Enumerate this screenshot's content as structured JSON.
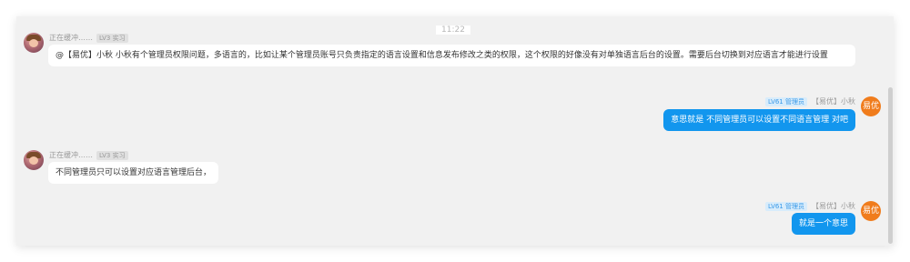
{
  "chat": {
    "timestamp": "11:22",
    "messages": [
      {
        "sender": "正在缓冲……",
        "badge": "LV3 实习",
        "text": "@【易优】小秋 小秋有个管理员权限问题，多语言的，比如让某个管理员账号只负责指定的语言设置和信息发布修改之类的权限，这个权限的好像没有对单独语言后台的设置。需要后台切换到对应语言才能进行设置"
      },
      {
        "sender": "【易优】小秋",
        "badge": "LV61 管理员",
        "avatar_text": "易优",
        "text": "意思就是  不同管理员可以设置不同语言管理 对吧"
      },
      {
        "sender": "正在缓冲……",
        "badge": "LV3 实习",
        "text": "不同管理员只可以设置对应语言管理后台，"
      },
      {
        "sender": "【易优】小秋",
        "badge": "LV61 管理员",
        "avatar_text": "易优",
        "text": "就是一个意思"
      }
    ]
  }
}
